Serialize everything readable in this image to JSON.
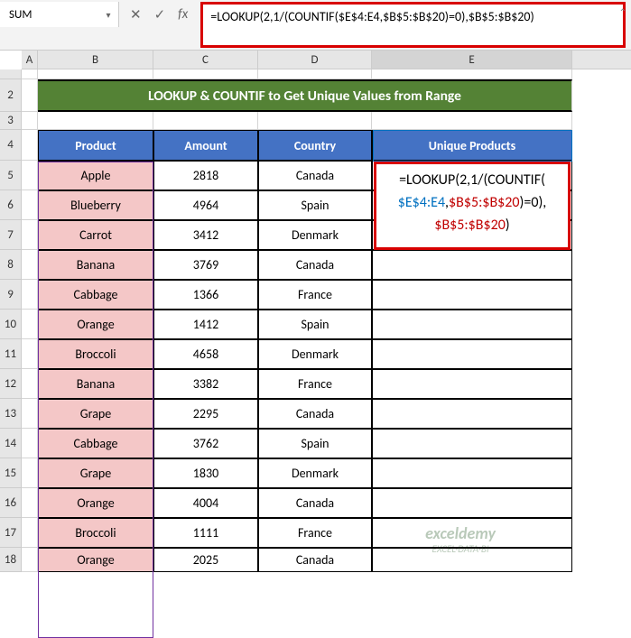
{
  "namebox": "SUM",
  "formula_bar": "=LOOKUP(2,1/(COUNTIF($E$4:E4,$B$5:$B$20)=0),$B$5:$B$20)",
  "title": "LOOKUP & COUNTIF to Get Unique Values from Range",
  "headers": {
    "b": "Product",
    "c": "Amount",
    "d": "Country",
    "e": "Unique Products"
  },
  "cols": {
    "A": "A",
    "B": "B",
    "C": "C",
    "D": "D",
    "E": "E"
  },
  "rows": [
    {
      "n": "5",
      "product": "Apple",
      "amount": "2818",
      "country": "Canada"
    },
    {
      "n": "6",
      "product": "Blueberry",
      "amount": "4964",
      "country": "Spain"
    },
    {
      "n": "7",
      "product": "Carrot",
      "amount": "3412",
      "country": "Denmark"
    },
    {
      "n": "8",
      "product": "Banana",
      "amount": "3769",
      "country": "Canada"
    },
    {
      "n": "9",
      "product": "Cabbage",
      "amount": "1366",
      "country": "France"
    },
    {
      "n": "10",
      "product": "Orange",
      "amount": "1412",
      "country": "Spain"
    },
    {
      "n": "11",
      "product": "Broccoli",
      "amount": "4658",
      "country": "Denmark"
    },
    {
      "n": "12",
      "product": "Banana",
      "amount": "3382",
      "country": "France"
    },
    {
      "n": "13",
      "product": "Grape",
      "amount": "2295",
      "country": "Canada"
    },
    {
      "n": "14",
      "product": "Cabbage",
      "amount": "3762",
      "country": "Spain"
    },
    {
      "n": "15",
      "product": "Grape",
      "amount": "1830",
      "country": "Denmark"
    },
    {
      "n": "16",
      "product": "Orange",
      "amount": "4004",
      "country": "Canada"
    },
    {
      "n": "17",
      "product": "Broccoli",
      "amount": "1111",
      "country": "France"
    },
    {
      "n": "18",
      "product": "Orange",
      "amount": "2025",
      "country": "Canada"
    }
  ],
  "overlay": {
    "p1a": "=LOOKUP(2,1/(COUNTIF(",
    "p2a": "$E$4:E4",
    "p2b": ",",
    "p2c": "$B$5:$B$20",
    "p2d": ")",
    "p2e": "=0),",
    "p3a": "$B$5:$B$20",
    "p3b": ")"
  },
  "watermark": {
    "l1": "exceldemy",
    "l2": "EXCEL·DATA·BI"
  }
}
